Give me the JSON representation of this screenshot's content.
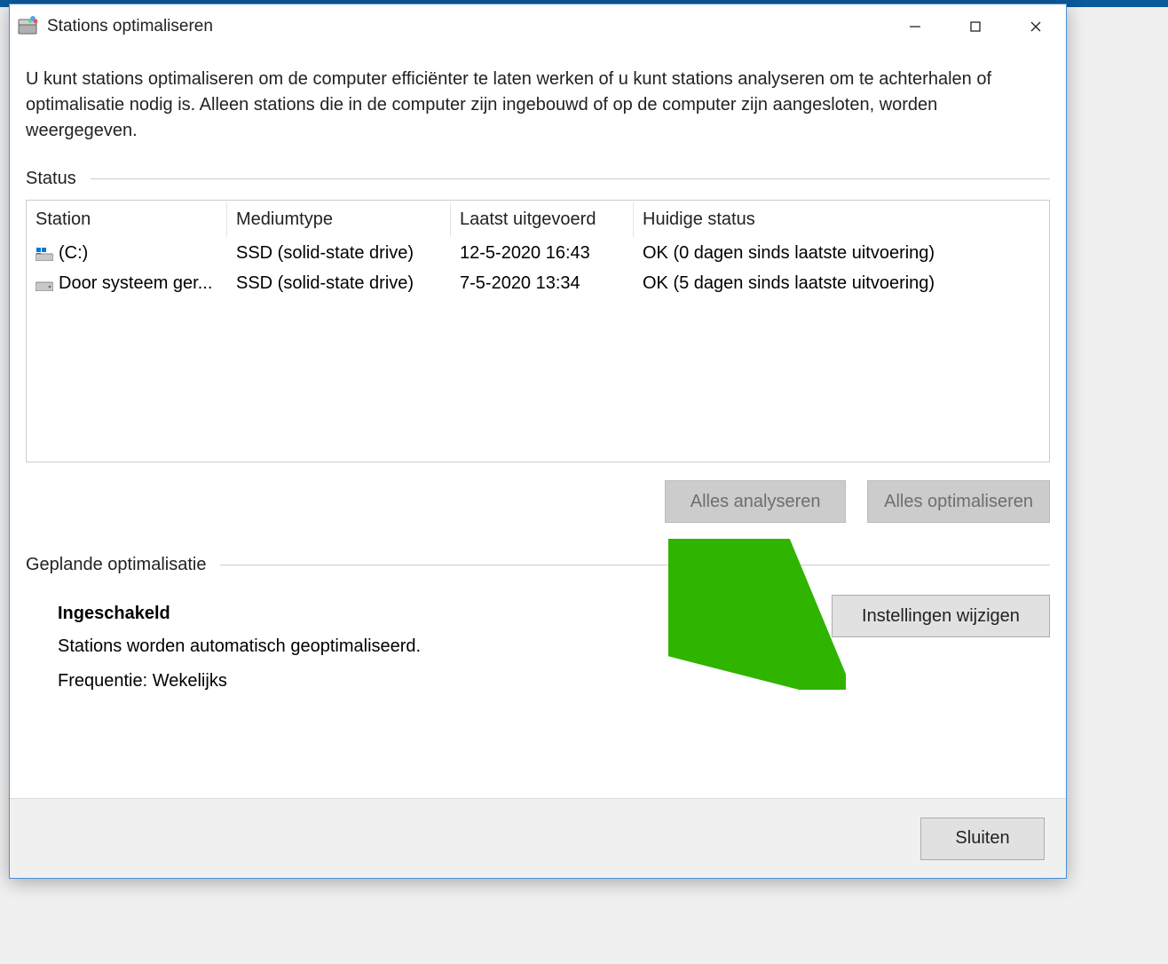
{
  "window": {
    "title": "Stations optimaliseren"
  },
  "description": "U kunt stations optimaliseren om de computer efficiënter te laten werken of u kunt stations analyseren om te achterhalen of optimalisatie nodig is. Alleen stations die in de computer zijn ingebouwd of op de computer zijn aangesloten, worden weergegeven.",
  "status_section": {
    "label": "Status",
    "columns": {
      "station": "Station",
      "medium": "Mediumtype",
      "last_run": "Laatst uitgevoerd",
      "current_status": "Huidige status"
    },
    "rows": [
      {
        "station": "(C:)",
        "icon": "windows",
        "medium": "SSD (solid-state drive)",
        "last_run": "12-5-2020 16:43",
        "status": "OK (0 dagen sinds laatste uitvoering)"
      },
      {
        "station": "Door systeem ger...",
        "icon": "drive",
        "medium": "SSD (solid-state drive)",
        "last_run": "7-5-2020 13:34",
        "status": "OK (5 dagen sinds laatste uitvoering)"
      }
    ]
  },
  "buttons": {
    "analyze_all": "Alles analyseren",
    "optimize_all": "Alles optimaliseren",
    "change_settings": "Instellingen wijzigen",
    "close": "Sluiten"
  },
  "schedule_section": {
    "label": "Geplande optimalisatie",
    "enabled_title": "Ingeschakeld",
    "description": "Stations worden automatisch geoptimaliseerd.",
    "frequency": "Frequentie: Wekelijks"
  },
  "annotation": {
    "arrow_color": "#2fb400"
  }
}
